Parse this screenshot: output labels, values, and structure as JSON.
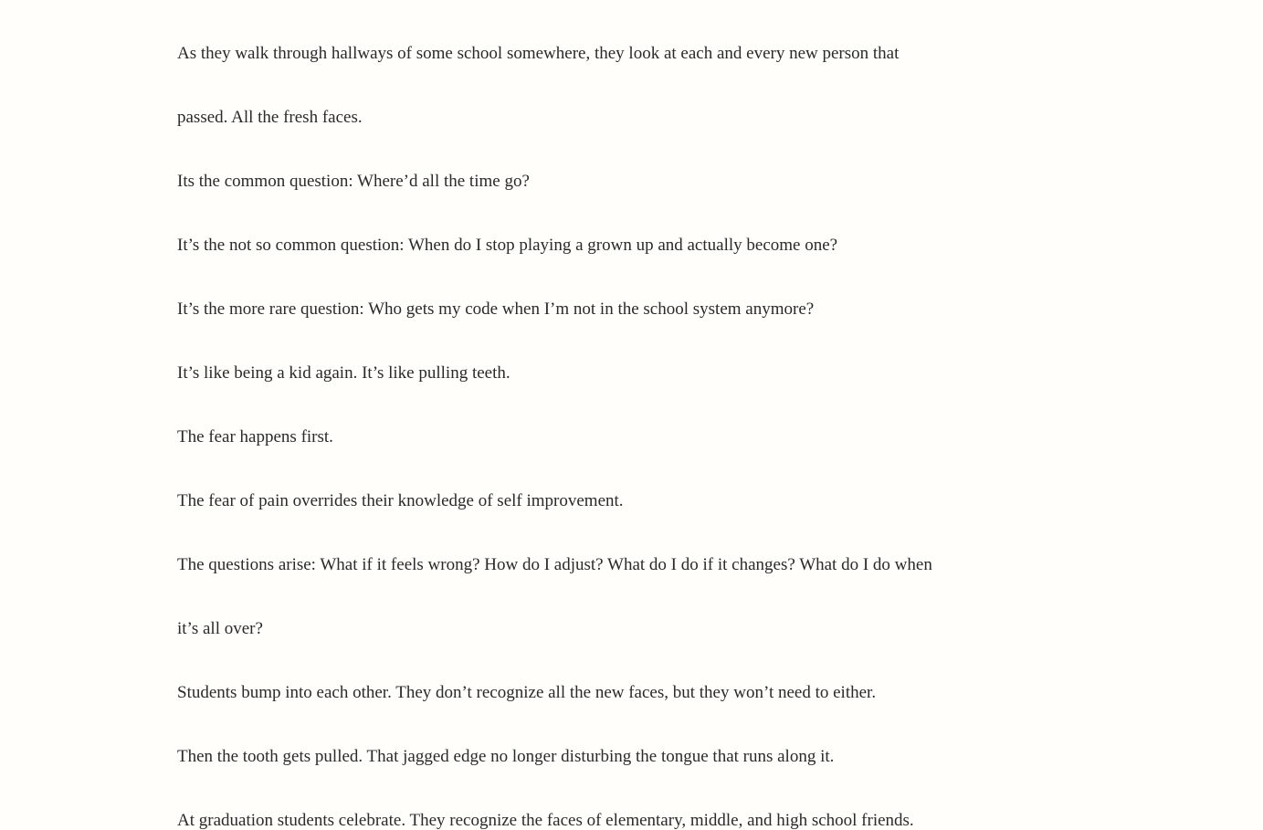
{
  "article": {
    "paragraphs": [
      "As they walk through hallways of some school somewhere, they look at each and every new person that",
      "passed. All the fresh faces.",
      "Its the common question: Where’d all the time go?",
      "It’s the not so common question: When do I stop playing a grown up and actually become one?",
      "It’s the more rare question: Who gets my code when I’m not in the school system anymore?",
      "It’s like being a kid again. It’s like pulling teeth.",
      "The fear happens first.",
      "The fear of pain overrides their knowledge of self improvement.",
      "The questions arise: What if it feels wrong? How do I adjust? What do I do if it changes? What do I do when",
      "it’s all over?",
      "Students bump into each other. They don’t recognize all the new faces, but they won’t need to either.",
      "Then the tooth gets pulled. That jagged edge no longer disturbing the tongue that runs along it.",
      "At graduation students celebrate. They recognize the faces of elementary, middle, and high school friends."
    ]
  },
  "colors": {
    "background": "#fffefa",
    "text": "#2a2a2a"
  }
}
